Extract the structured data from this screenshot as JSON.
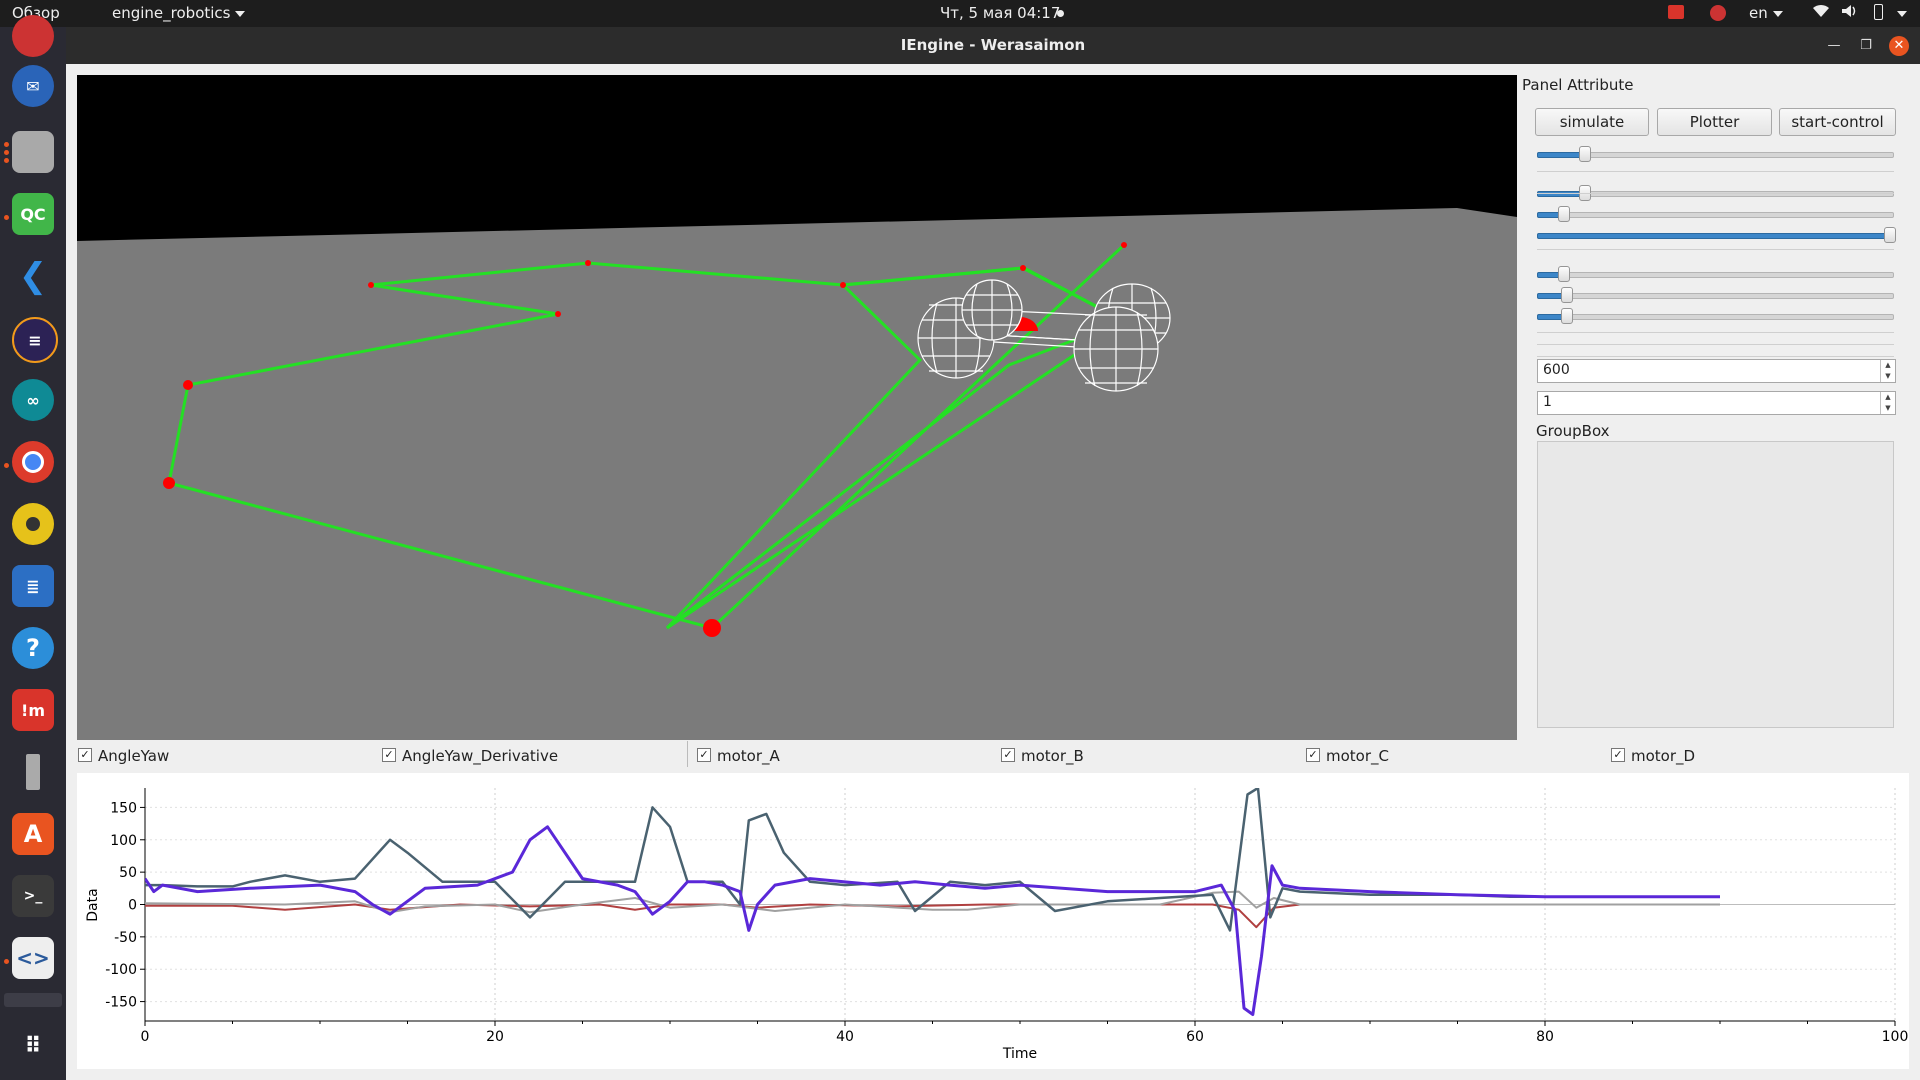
{
  "topbar": {
    "overview": "Обзор",
    "app_menu": "engine_robotics",
    "clock": "Чт, 5 мая  04:17",
    "lang": "en"
  },
  "window": {
    "title": "IEngine - Werasaimon"
  },
  "dock": {
    "apps": [
      "firefox-icon",
      "thunderbird-icon",
      "files-icon",
      "qt-creator-icon",
      "vscode-icon",
      "eclipse-icon",
      "arduino-icon",
      "chrome-icon",
      "rhythmbox-icon",
      "writer-icon",
      "help-icon",
      "remmina-icon",
      "usb-icon",
      "software-center-icon",
      "terminal-icon",
      "code-editor-icon",
      "show-apps-icon"
    ],
    "qc_label": "QC"
  },
  "panel": {
    "title": "Panel Attribute",
    "buttons": {
      "simulate": "simulate",
      "plotter": "Plotter",
      "start_control": "start-control"
    },
    "sliders": [
      0.12,
      0.12,
      0.06,
      1.0,
      0.06,
      0.07,
      0.07
    ],
    "spin1": "600",
    "spin2": "1",
    "groupbox": "GroupBox"
  },
  "checkboxes": [
    {
      "label": "AngleYaw",
      "checked": true
    },
    {
      "label": "AngleYaw_Derivative",
      "checked": true
    },
    {
      "label": "motor_A",
      "checked": true
    },
    {
      "label": "motor_B",
      "checked": true
    },
    {
      "label": "motor_C",
      "checked": true
    },
    {
      "label": "motor_D",
      "checked": true
    }
  ],
  "chart_data": {
    "type": "line",
    "xlabel": "Time",
    "ylabel": "Data",
    "xlim": [
      0,
      100
    ],
    "ylim": [
      -180,
      180
    ],
    "xticks": [
      0,
      20,
      40,
      60,
      80,
      100
    ],
    "yticks": [
      150,
      100,
      50,
      0,
      -50,
      -100,
      -150
    ],
    "grid": true,
    "colors": {
      "red": "#b04040",
      "gray": "#a0a0a0",
      "slate": "#4a6270",
      "violet": "#5a28d8"
    },
    "series": [
      {
        "color_key": "red",
        "x": [
          0,
          5,
          8,
          12,
          14,
          18,
          22,
          26,
          28,
          30,
          33,
          35,
          38,
          43,
          48,
          52,
          55,
          58,
          61,
          62.5,
          63.5,
          64.5,
          66,
          70,
          75,
          80,
          85,
          90
        ],
        "y": [
          -2,
          -2,
          -8,
          0,
          -8,
          0,
          -3,
          0,
          -8,
          0,
          0,
          -5,
          0,
          -3,
          0,
          0,
          0,
          0,
          0,
          -8,
          -35,
          -5,
          0,
          0,
          0,
          0,
          0,
          0
        ]
      },
      {
        "color_key": "gray",
        "x": [
          0,
          8,
          12,
          14,
          16,
          20,
          22,
          25,
          28,
          30,
          33,
          36,
          40,
          45,
          47,
          50,
          55,
          58,
          61,
          62.5,
          63.5,
          64.5,
          66,
          70,
          80,
          90
        ],
        "y": [
          2,
          0,
          5,
          -12,
          -3,
          0,
          -12,
          0,
          10,
          -5,
          0,
          -10,
          0,
          -8,
          -8,
          0,
          0,
          0,
          18,
          20,
          -5,
          10,
          0,
          0,
          0,
          0
        ]
      },
      {
        "color_key": "slate",
        "x": [
          0,
          1,
          3,
          5,
          6,
          8,
          10,
          12,
          14,
          15,
          17,
          20,
          22,
          24,
          26,
          28,
          29,
          30,
          31,
          33,
          34,
          34.5,
          35.5,
          36.5,
          38,
          40,
          43,
          44,
          46,
          48,
          50,
          52,
          55,
          58,
          61,
          62,
          63,
          63.6,
          64.3,
          65,
          66,
          70,
          72,
          75,
          78,
          80,
          85,
          90
        ],
        "y": [
          30,
          30,
          28,
          28,
          35,
          45,
          35,
          40,
          100,
          80,
          35,
          35,
          -20,
          35,
          35,
          35,
          150,
          120,
          35,
          35,
          0,
          130,
          140,
          80,
          35,
          30,
          35,
          -10,
          35,
          30,
          35,
          -10,
          5,
          10,
          15,
          -40,
          170,
          180,
          -20,
          25,
          20,
          15,
          15,
          15,
          12,
          12,
          12,
          12
        ]
      },
      {
        "color_key": "violet",
        "x": [
          0,
          0.5,
          1,
          3,
          6,
          10,
          12,
          13,
          14,
          16,
          19,
          21,
          22,
          23,
          25,
          27,
          28,
          29,
          30,
          31,
          32,
          33,
          34,
          34.5,
          35,
          36,
          38,
          42,
          44,
          46,
          48,
          50,
          55,
          60,
          61.5,
          62.3,
          62.8,
          63.3,
          63.8,
          64.4,
          65,
          66,
          70,
          75,
          80,
          85,
          90
        ],
        "y": [
          40,
          20,
          30,
          20,
          25,
          30,
          20,
          0,
          -15,
          25,
          30,
          50,
          100,
          120,
          40,
          30,
          20,
          -15,
          5,
          35,
          35,
          30,
          20,
          -40,
          0,
          30,
          40,
          30,
          35,
          30,
          25,
          30,
          20,
          20,
          30,
          -10,
          -160,
          -170,
          -80,
          60,
          30,
          25,
          20,
          15,
          12,
          12,
          12
        ]
      }
    ]
  }
}
